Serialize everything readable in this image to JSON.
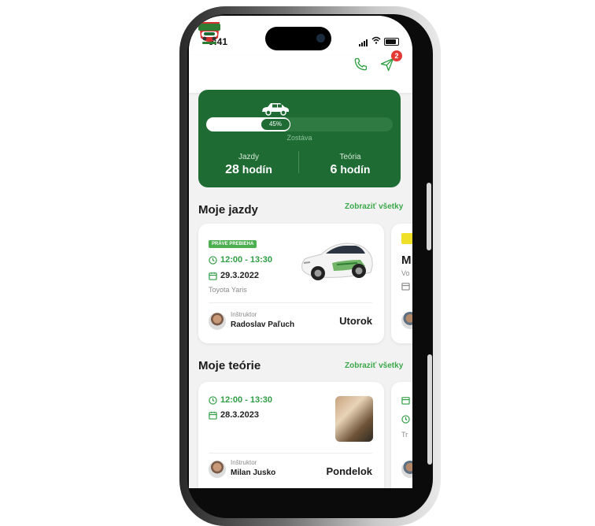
{
  "status_bar": {
    "time": "9:41"
  },
  "app_bar": {
    "notifications_count": "2",
    "icons": [
      "app-logo",
      "phone-icon",
      "send-icon"
    ]
  },
  "progress": {
    "percent_label": "45%",
    "percent_value": 45,
    "remaining_label": "Zostáva",
    "rides": {
      "label": "Jazdy",
      "number": "28",
      "unit": "hodín"
    },
    "theory": {
      "label": "Teória",
      "number": "6",
      "unit": "hodín"
    }
  },
  "rides_section": {
    "title": "Moje jazdy",
    "show_all": "Zobraziť všetky",
    "card": {
      "tag": "PRÁVE PREBIEHA",
      "time": "12:00 - 13:30",
      "date": "29.3.2022",
      "car": "Toyota Yaris",
      "instructor_label": "Inštruktor",
      "instructor_name": "Radoslav Paľuch",
      "day": "Utorok"
    },
    "next_card": {
      "title_initial": "M",
      "subtitle_fragment": "Vo"
    }
  },
  "theory_section": {
    "title": "Moje teórie",
    "show_all": "Zobraziť všetky",
    "card": {
      "time": "12:00 - 13:30",
      "date": "28.3.2023",
      "instructor_label": "Inštruktor",
      "instructor_name": "Milan Jusko",
      "day": "Pondelok"
    },
    "next_card": {
      "subtitle_fragment": "Tr"
    }
  },
  "colors": {
    "brand_green": "#1e6b34",
    "accent_green": "#3aa84a",
    "badge_red": "#e53935",
    "tag_yellow": "#f1e02a"
  }
}
